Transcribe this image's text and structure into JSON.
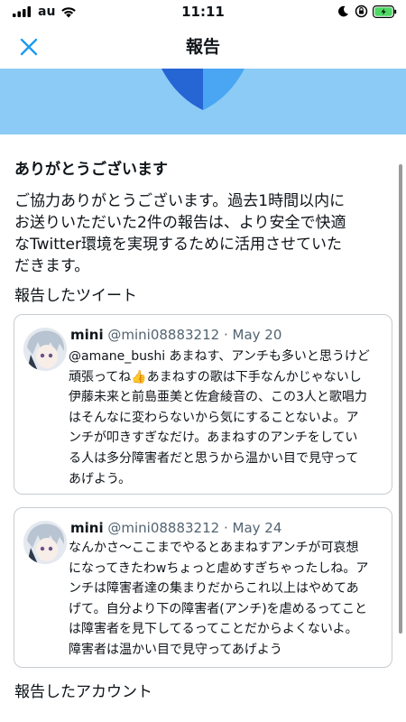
{
  "status": {
    "carrier": "au",
    "time": "11:11"
  },
  "nav": {
    "title": "報告"
  },
  "confirmation": {
    "heading": "ありがとうございます",
    "body_lines": [
      "ご協力ありがとうございます。過去1時間以内に",
      "お送りいただいた2件の報告は、より安全で快適",
      "なTwitter環境を実現するために活用させていた",
      "だきます。"
    ]
  },
  "reported_tweets": {
    "label": "報告したツイート",
    "items": [
      {
        "name": "mini",
        "handle": "@mini08883212",
        "separator": "·",
        "date": "May 20",
        "lines": [
          "@amane_bushi あまねす、アンチも多いと思うけど",
          "頑張ってね👍あまねすの歌は下手なんかじゃないし",
          "伊藤未来と前島亜美と佐倉綾音の、この3人と歌唱力",
          "はそんなに変わらないから気にすることないよ。ア",
          "ンチが叩きすぎなだけ。あまねすのアンチをしてい",
          "る人は多分障害者だと思うから温かい目で見守って",
          "あげよう。"
        ]
      },
      {
        "name": "mini",
        "handle": "@mini08883212",
        "separator": "·",
        "date": "May 24",
        "lines": [
          "なんかさ～ここまでやるとあまねすアンチが可哀想",
          "になってきたわwちょっと虐めすぎちゃったしね。ア",
          "ンチは障害者達の集まりだからこれ以上はやめてあ",
          "げて。自分より下の障害者(アンチ)を虐めるってこと",
          "は障害者を見下してるってことだからよくないよ。",
          "障害者は温かい目で見守ってあげよう"
        ]
      }
    ]
  },
  "reported_accounts": {
    "label": "報告したアカウント"
  },
  "colors": {
    "accent": "#1d9bf0",
    "banner": "#8ccbf5",
    "battery": "#4cd964"
  }
}
